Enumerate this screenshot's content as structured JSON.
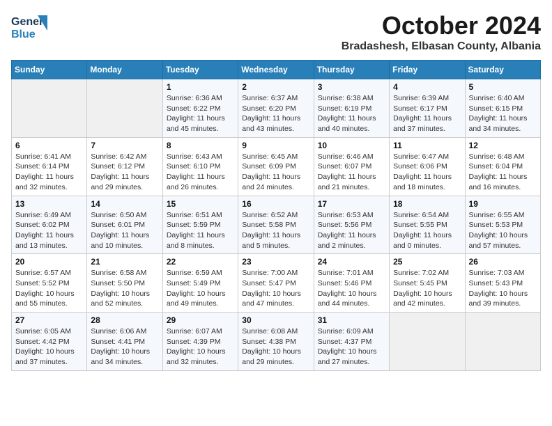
{
  "logo": {
    "line1": "General",
    "line2": "Blue"
  },
  "header": {
    "month": "October 2024",
    "location": "Bradashesh, Elbasan County, Albania"
  },
  "weekdays": [
    "Sunday",
    "Monday",
    "Tuesday",
    "Wednesday",
    "Thursday",
    "Friday",
    "Saturday"
  ],
  "weeks": [
    [
      {
        "day": "",
        "sunrise": "",
        "sunset": "",
        "daylight": ""
      },
      {
        "day": "",
        "sunrise": "",
        "sunset": "",
        "daylight": ""
      },
      {
        "day": "1",
        "sunrise": "Sunrise: 6:36 AM",
        "sunset": "Sunset: 6:22 PM",
        "daylight": "Daylight: 11 hours and 45 minutes."
      },
      {
        "day": "2",
        "sunrise": "Sunrise: 6:37 AM",
        "sunset": "Sunset: 6:20 PM",
        "daylight": "Daylight: 11 hours and 43 minutes."
      },
      {
        "day": "3",
        "sunrise": "Sunrise: 6:38 AM",
        "sunset": "Sunset: 6:19 PM",
        "daylight": "Daylight: 11 hours and 40 minutes."
      },
      {
        "day": "4",
        "sunrise": "Sunrise: 6:39 AM",
        "sunset": "Sunset: 6:17 PM",
        "daylight": "Daylight: 11 hours and 37 minutes."
      },
      {
        "day": "5",
        "sunrise": "Sunrise: 6:40 AM",
        "sunset": "Sunset: 6:15 PM",
        "daylight": "Daylight: 11 hours and 34 minutes."
      }
    ],
    [
      {
        "day": "6",
        "sunrise": "Sunrise: 6:41 AM",
        "sunset": "Sunset: 6:14 PM",
        "daylight": "Daylight: 11 hours and 32 minutes."
      },
      {
        "day": "7",
        "sunrise": "Sunrise: 6:42 AM",
        "sunset": "Sunset: 6:12 PM",
        "daylight": "Daylight: 11 hours and 29 minutes."
      },
      {
        "day": "8",
        "sunrise": "Sunrise: 6:43 AM",
        "sunset": "Sunset: 6:10 PM",
        "daylight": "Daylight: 11 hours and 26 minutes."
      },
      {
        "day": "9",
        "sunrise": "Sunrise: 6:45 AM",
        "sunset": "Sunset: 6:09 PM",
        "daylight": "Daylight: 11 hours and 24 minutes."
      },
      {
        "day": "10",
        "sunrise": "Sunrise: 6:46 AM",
        "sunset": "Sunset: 6:07 PM",
        "daylight": "Daylight: 11 hours and 21 minutes."
      },
      {
        "day": "11",
        "sunrise": "Sunrise: 6:47 AM",
        "sunset": "Sunset: 6:06 PM",
        "daylight": "Daylight: 11 hours and 18 minutes."
      },
      {
        "day": "12",
        "sunrise": "Sunrise: 6:48 AM",
        "sunset": "Sunset: 6:04 PM",
        "daylight": "Daylight: 11 hours and 16 minutes."
      }
    ],
    [
      {
        "day": "13",
        "sunrise": "Sunrise: 6:49 AM",
        "sunset": "Sunset: 6:02 PM",
        "daylight": "Daylight: 11 hours and 13 minutes."
      },
      {
        "day": "14",
        "sunrise": "Sunrise: 6:50 AM",
        "sunset": "Sunset: 6:01 PM",
        "daylight": "Daylight: 11 hours and 10 minutes."
      },
      {
        "day": "15",
        "sunrise": "Sunrise: 6:51 AM",
        "sunset": "Sunset: 5:59 PM",
        "daylight": "Daylight: 11 hours and 8 minutes."
      },
      {
        "day": "16",
        "sunrise": "Sunrise: 6:52 AM",
        "sunset": "Sunset: 5:58 PM",
        "daylight": "Daylight: 11 hours and 5 minutes."
      },
      {
        "day": "17",
        "sunrise": "Sunrise: 6:53 AM",
        "sunset": "Sunset: 5:56 PM",
        "daylight": "Daylight: 11 hours and 2 minutes."
      },
      {
        "day": "18",
        "sunrise": "Sunrise: 6:54 AM",
        "sunset": "Sunset: 5:55 PM",
        "daylight": "Daylight: 11 hours and 0 minutes."
      },
      {
        "day": "19",
        "sunrise": "Sunrise: 6:55 AM",
        "sunset": "Sunset: 5:53 PM",
        "daylight": "Daylight: 10 hours and 57 minutes."
      }
    ],
    [
      {
        "day": "20",
        "sunrise": "Sunrise: 6:57 AM",
        "sunset": "Sunset: 5:52 PM",
        "daylight": "Daylight: 10 hours and 55 minutes."
      },
      {
        "day": "21",
        "sunrise": "Sunrise: 6:58 AM",
        "sunset": "Sunset: 5:50 PM",
        "daylight": "Daylight: 10 hours and 52 minutes."
      },
      {
        "day": "22",
        "sunrise": "Sunrise: 6:59 AM",
        "sunset": "Sunset: 5:49 PM",
        "daylight": "Daylight: 10 hours and 49 minutes."
      },
      {
        "day": "23",
        "sunrise": "Sunrise: 7:00 AM",
        "sunset": "Sunset: 5:47 PM",
        "daylight": "Daylight: 10 hours and 47 minutes."
      },
      {
        "day": "24",
        "sunrise": "Sunrise: 7:01 AM",
        "sunset": "Sunset: 5:46 PM",
        "daylight": "Daylight: 10 hours and 44 minutes."
      },
      {
        "day": "25",
        "sunrise": "Sunrise: 7:02 AM",
        "sunset": "Sunset: 5:45 PM",
        "daylight": "Daylight: 10 hours and 42 minutes."
      },
      {
        "day": "26",
        "sunrise": "Sunrise: 7:03 AM",
        "sunset": "Sunset: 5:43 PM",
        "daylight": "Daylight: 10 hours and 39 minutes."
      }
    ],
    [
      {
        "day": "27",
        "sunrise": "Sunrise: 6:05 AM",
        "sunset": "Sunset: 4:42 PM",
        "daylight": "Daylight: 10 hours and 37 minutes."
      },
      {
        "day": "28",
        "sunrise": "Sunrise: 6:06 AM",
        "sunset": "Sunset: 4:41 PM",
        "daylight": "Daylight: 10 hours and 34 minutes."
      },
      {
        "day": "29",
        "sunrise": "Sunrise: 6:07 AM",
        "sunset": "Sunset: 4:39 PM",
        "daylight": "Daylight: 10 hours and 32 minutes."
      },
      {
        "day": "30",
        "sunrise": "Sunrise: 6:08 AM",
        "sunset": "Sunset: 4:38 PM",
        "daylight": "Daylight: 10 hours and 29 minutes."
      },
      {
        "day": "31",
        "sunrise": "Sunrise: 6:09 AM",
        "sunset": "Sunset: 4:37 PM",
        "daylight": "Daylight: 10 hours and 27 minutes."
      },
      {
        "day": "",
        "sunrise": "",
        "sunset": "",
        "daylight": ""
      },
      {
        "day": "",
        "sunrise": "",
        "sunset": "",
        "daylight": ""
      }
    ]
  ]
}
